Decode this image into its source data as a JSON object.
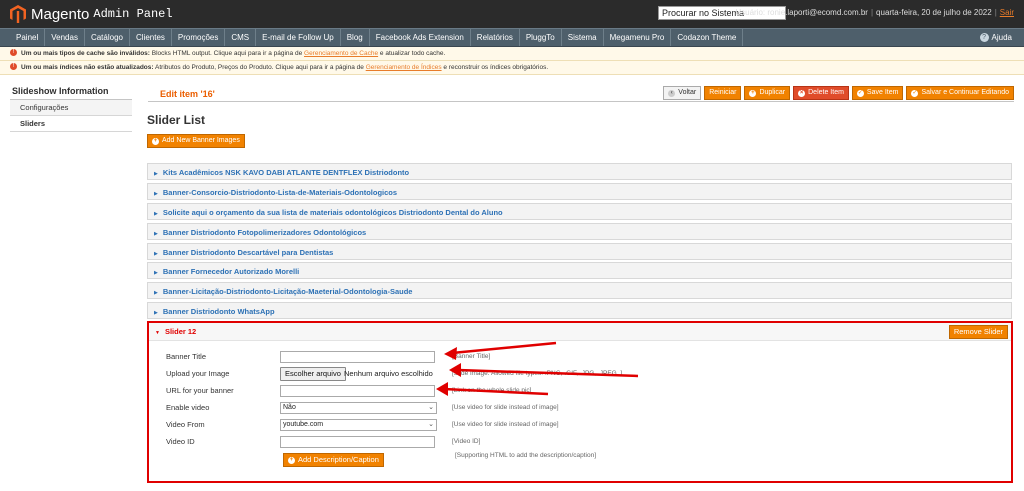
{
  "header": {
    "brand": "Magento",
    "subtitle": "Admin Panel",
    "search_value": "Procurar no Sistema",
    "user_text": "Usuário: ronie.laporti@ecomd.com.br",
    "date_text": "quarta-feira, 20 de julho de 2022",
    "logout": "Sair"
  },
  "nav": {
    "items": [
      "Painel",
      "Vendas",
      "Catálogo",
      "Clientes",
      "Promoções",
      "CMS",
      "E-mail de Follow Up",
      "Blog",
      "Facebook Ads Extension",
      "Relatórios",
      "PluggTo",
      "Sistema",
      "Megamenu Pro",
      "Codazon Theme"
    ],
    "help": "Ajuda"
  },
  "notices": {
    "cache": {
      "strong": "Um ou mais tipos de cache são inválidos:",
      "text": "Blocks HTML output. Clique aqui para ir a página de",
      "link": "Gerenciamento de Cache",
      "tail": "e atualizar todo cache."
    },
    "index": {
      "strong": "Um ou mais índices não estão atualizados:",
      "text": "Atributos do Produto, Preços do Produto. Clique aqui para ir a página de",
      "link": "Gerenciamento de Índices",
      "tail": "e reconstruir os índices obrigatórios."
    }
  },
  "sidebar": {
    "title": "Slideshow Information",
    "tabs": [
      "Configurações",
      "Sliders"
    ]
  },
  "main": {
    "edit_title": "Edit item '16'",
    "actions": [
      "Voltar",
      "Reiniciar",
      "Duplicar",
      "Delete Item",
      "Save Item",
      "Salvar e Continuar Editando"
    ],
    "page_title": "Slider List",
    "add_banner": "Add New Banner Images",
    "sliders": [
      "Kits Acadêmicos NSK KAVO DABI ATLANTE DENTFLEX Distriodonto",
      "Banner-Consorcio-Distriodonto-Lista-de-Materiais-Odontologicos",
      "Solicite aqui o orçamento da sua lista de materiais odontológicos Distriodonto Dental do Aluno",
      "Banner Distriodonto Fotopolimerizadores Odontológicos",
      "Banner Distriodonto Descartável para Dentistas",
      "Banner Fornecedor Autorizado Morelli",
      "Banner-Licitação-Distriodonto-Licitação-Maeterial-Odontologia-Saude",
      "Banner Distriodonto WhatsApp"
    ]
  },
  "slider_form": {
    "title": "Slider 12",
    "remove": "Remove Slider",
    "banner_title_label": "Banner Title",
    "banner_title_note": "[Banner Title]",
    "upload_label": "Upload your Image",
    "file_button": "Escolher arquivo",
    "file_status": "Nenhum arquivo escolhido",
    "upload_note": "[Slide image. Allowed file types: .PNG, .GIF, .JPG, .JPEG. ]",
    "url_label": "URL for your banner",
    "url_note": "[Link on the whole slide pic]",
    "enable_video_label": "Enable video",
    "enable_video_value": "Não",
    "enable_video_note": "[Use video for slide instead of image]",
    "video_from_label": "Video From",
    "video_from_value": "youtube.com",
    "video_from_note": "[Use video for slide instead of image]",
    "video_id_label": "Video ID",
    "video_id_note": "[Video ID]",
    "add_desc": "Add Description/Caption",
    "add_desc_note": "[Supporting HTML to add the description/caption]"
  },
  "colors": {
    "accent": "#f18200",
    "highlight": "#e00000",
    "link": "#2d71b5",
    "nav_bg": "#4e5f6b",
    "header_bg": "#2b2b2b"
  }
}
